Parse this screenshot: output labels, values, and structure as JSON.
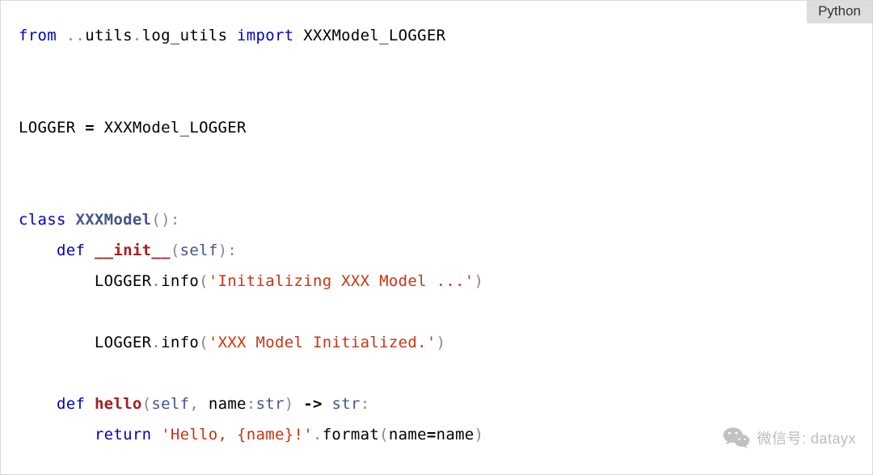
{
  "language_label": "Python",
  "watermark_text": "微信号: datayx",
  "code": {
    "lines": [
      [
        {
          "cls": "tok-kw",
          "t": "from"
        },
        {
          "cls": "tok-black",
          "t": " "
        },
        {
          "cls": "tok-grey",
          "t": ".."
        },
        {
          "cls": "tok-black",
          "t": "utils"
        },
        {
          "cls": "tok-grey",
          "t": "."
        },
        {
          "cls": "tok-black",
          "t": "log_utils "
        },
        {
          "cls": "tok-kw",
          "t": "import"
        },
        {
          "cls": "tok-black",
          "t": " XXXModel_LOGGER"
        }
      ],
      [],
      [],
      [
        {
          "cls": "tok-black",
          "t": "LOGGER "
        },
        {
          "cls": "tok-op",
          "t": "="
        },
        {
          "cls": "tok-black",
          "t": " XXXModel_LOGGER"
        }
      ],
      [],
      [],
      [
        {
          "cls": "tok-kw",
          "t": "class"
        },
        {
          "cls": "tok-black",
          "t": " "
        },
        {
          "cls": "tok-classnm",
          "t": "XXXModel"
        },
        {
          "cls": "tok-grey",
          "t": "():"
        }
      ],
      [
        {
          "cls": "tok-black",
          "t": "    "
        },
        {
          "cls": "tok-kw",
          "t": "def"
        },
        {
          "cls": "tok-black",
          "t": " "
        },
        {
          "cls": "tok-defname",
          "t": "__init__"
        },
        {
          "cls": "tok-grey",
          "t": "("
        },
        {
          "cls": "tok-builtin",
          "t": "self"
        },
        {
          "cls": "tok-grey",
          "t": "):"
        }
      ],
      [
        {
          "cls": "tok-black",
          "t": "        LOGGER"
        },
        {
          "cls": "tok-grey",
          "t": "."
        },
        {
          "cls": "tok-black",
          "t": "info"
        },
        {
          "cls": "tok-grey",
          "t": "("
        },
        {
          "cls": "tok-string",
          "t": "'Initializing XXX Model ...'"
        },
        {
          "cls": "tok-grey",
          "t": ")"
        }
      ],
      [],
      [
        {
          "cls": "tok-black",
          "t": "        LOGGER"
        },
        {
          "cls": "tok-grey",
          "t": "."
        },
        {
          "cls": "tok-black",
          "t": "info"
        },
        {
          "cls": "tok-grey",
          "t": "("
        },
        {
          "cls": "tok-string",
          "t": "'XXX Model Initialized.'"
        },
        {
          "cls": "tok-grey",
          "t": ")"
        }
      ],
      [],
      [
        {
          "cls": "tok-black",
          "t": "    "
        },
        {
          "cls": "tok-kw",
          "t": "def"
        },
        {
          "cls": "tok-black",
          "t": " "
        },
        {
          "cls": "tok-defname",
          "t": "hello"
        },
        {
          "cls": "tok-grey",
          "t": "("
        },
        {
          "cls": "tok-builtin",
          "t": "self"
        },
        {
          "cls": "tok-grey",
          "t": ", "
        },
        {
          "cls": "tok-black",
          "t": "name"
        },
        {
          "cls": "tok-grey",
          "t": ":"
        },
        {
          "cls": "tok-builtin",
          "t": "str"
        },
        {
          "cls": "tok-grey",
          "t": ") "
        },
        {
          "cls": "tok-op",
          "t": "->"
        },
        {
          "cls": "tok-grey",
          "t": " "
        },
        {
          "cls": "tok-builtin",
          "t": "str"
        },
        {
          "cls": "tok-grey",
          "t": ":"
        }
      ],
      [
        {
          "cls": "tok-black",
          "t": "        "
        },
        {
          "cls": "tok-kw",
          "t": "return"
        },
        {
          "cls": "tok-black",
          "t": " "
        },
        {
          "cls": "tok-string",
          "t": "'Hello, {name}!'"
        },
        {
          "cls": "tok-grey",
          "t": "."
        },
        {
          "cls": "tok-black",
          "t": "format"
        },
        {
          "cls": "tok-grey",
          "t": "("
        },
        {
          "cls": "tok-black",
          "t": "name"
        },
        {
          "cls": "tok-op",
          "t": "="
        },
        {
          "cls": "tok-black",
          "t": "name"
        },
        {
          "cls": "tok-grey",
          "t": ")"
        }
      ]
    ]
  }
}
